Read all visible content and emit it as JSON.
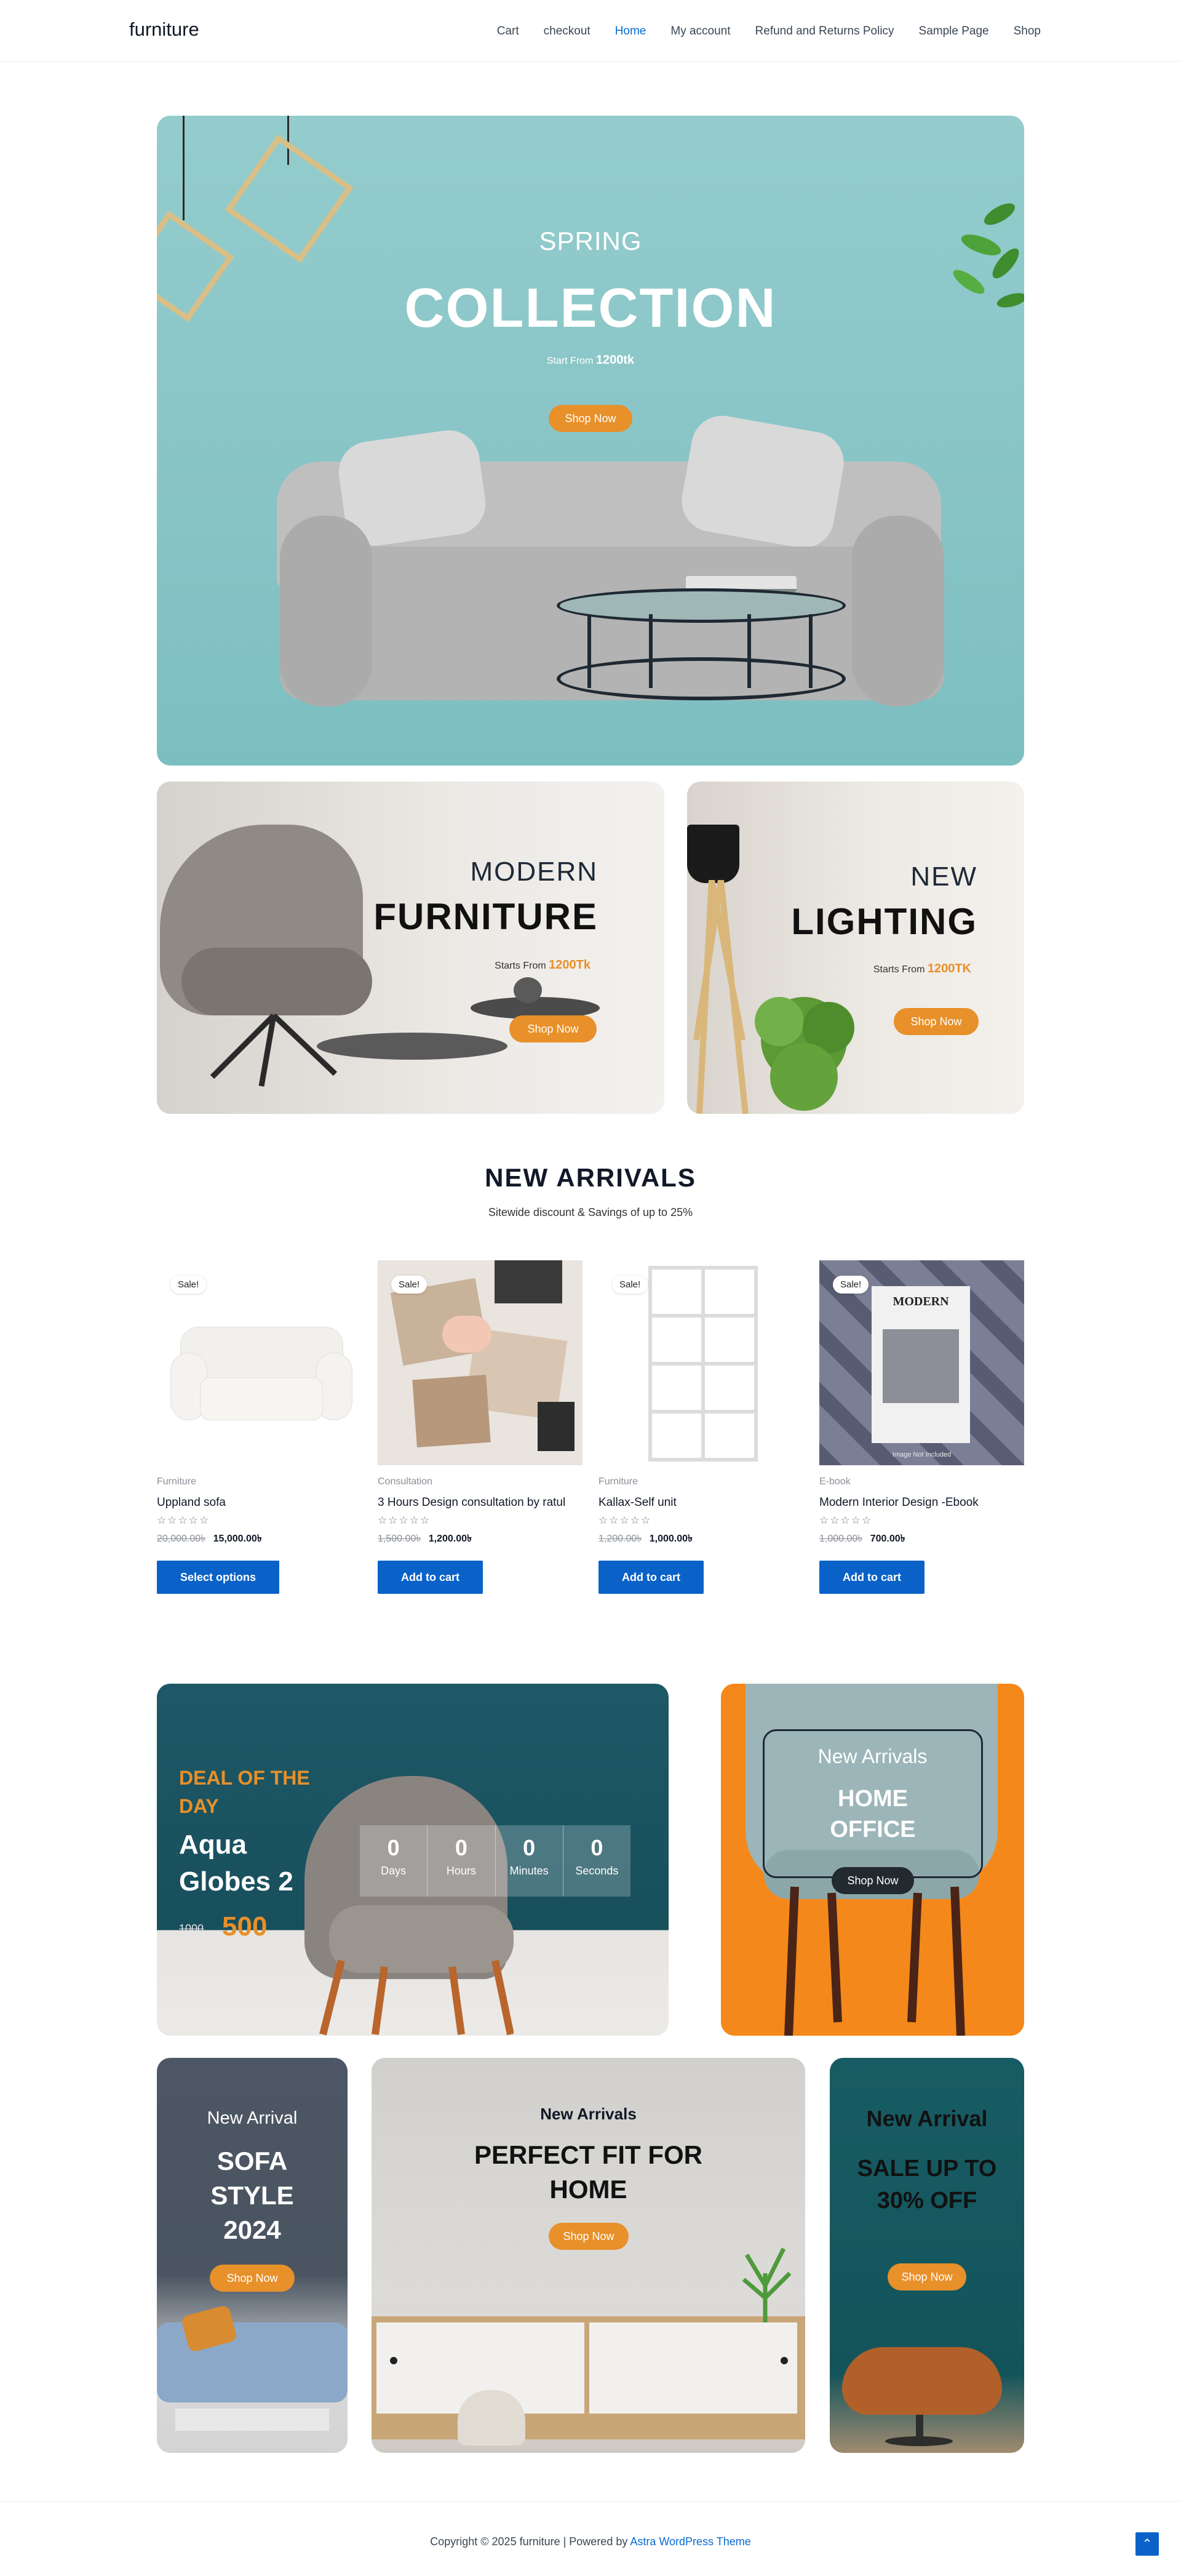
{
  "header": {
    "logo": "furniture",
    "nav": [
      "Cart",
      "checkout",
      "Home",
      "My account",
      "Refund and Returns Policy",
      "Sample Page",
      "Shop"
    ],
    "active": "Home"
  },
  "hero": {
    "subtitle": "SPRING",
    "title": "COLLECTION",
    "start_prefix": "Start From",
    "start_price": "1200tk",
    "button": "Shop Now"
  },
  "promo_modern": {
    "line1": "MODERN",
    "line2": "FURNITURE",
    "starts_prefix": "Starts From",
    "price": "1200Tk",
    "button": "Shop Now"
  },
  "promo_lighting": {
    "line1": "NEW",
    "line2": "LIGHTING",
    "starts_prefix": "Starts From",
    "price": "1200TK",
    "button": "Shop Now"
  },
  "arrivals": {
    "title": "NEW ARRIVALS",
    "subtitle": "Sitewide discount & Savings of up to 25%",
    "products": [
      {
        "badge": "Sale!",
        "category": "Furniture",
        "name": "Uppland sofa",
        "old_price": "20,000.00৳",
        "price": "15,000.00৳",
        "button": "Select options"
      },
      {
        "badge": "Sale!",
        "category": "Consultation",
        "name": "3 Hours Design consultation by ratul",
        "old_price": "1,500.00৳",
        "price": "1,200.00৳",
        "button": "Add to cart"
      },
      {
        "badge": "Sale!",
        "category": "Furniture",
        "name": "Kallax-Self unit",
        "old_price": "1,200.00৳",
        "price": "1,000.00৳",
        "button": "Add to cart"
      },
      {
        "badge": "Sale!",
        "category": "E-book",
        "name": "Modern Interior Design -Ebook",
        "old_price": "1,000.00৳",
        "price": "700.00৳",
        "button": "Add to cart"
      }
    ],
    "ebook_cover_title": "MODERN",
    "ebook_cover_note": "Image Not Included"
  },
  "deal": {
    "label": "DEAL OF THE DAY",
    "name": "Aqua Globes 2",
    "old_price": "1000",
    "price": "500",
    "countdown": [
      {
        "value": "0",
        "label": "Days"
      },
      {
        "value": "0",
        "label": "Hours"
      },
      {
        "value": "0",
        "label": "Minutes"
      },
      {
        "value": "0",
        "label": "Seconds"
      }
    ]
  },
  "office": {
    "line1": "New Arrivals",
    "line2": "HOME OFFICE",
    "button": "Shop Now"
  },
  "sofa_style": {
    "line1": "New Arrival",
    "line2": "SOFA STYLE 2024",
    "button": "Shop Now"
  },
  "perfect_fit": {
    "line1": "New Arrivals",
    "line2": "PERFECT FIT FOR HOME",
    "button": "Shop Now"
  },
  "sale_card": {
    "line1": "New Arrival",
    "line2": "SALE UP TO 30% OFF",
    "button": "Shop Now"
  },
  "footer": {
    "copyright": "Copyright © 2025 furniture | Powered by",
    "theme_link": "Astra WordPress Theme"
  },
  "colors": {
    "accent_orange": "#e8902a",
    "button_blue": "#0a62c9",
    "active_nav": "#0a6ad1"
  },
  "icons": {
    "scroll_top": "chevron-up-icon"
  }
}
